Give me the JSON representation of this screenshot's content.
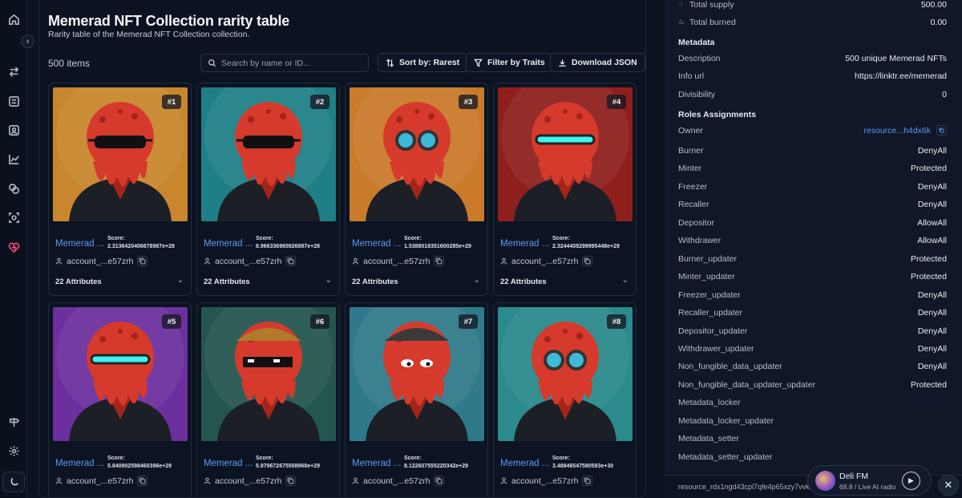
{
  "header": {
    "title": "Memerad NFT Collection rarity table",
    "subtitle": "Rarity table of the Memerad NFT Collection collection."
  },
  "toolbar": {
    "item_count": "500 items",
    "search_placeholder": "Search by name or ID...",
    "sort_label": "Sort by: Rarest",
    "filter_label": "Filter by Traits",
    "download_label": "Download JSON"
  },
  "cards": [
    {
      "rank": "#1",
      "name": "Memerad ...",
      "score_label": "Score:",
      "score": "2.3136420406678987e+28",
      "account": "account_...e57zrh",
      "attributes": "22 Attributes",
      "bg": "#c9862d",
      "accessory": "sunglasses"
    },
    {
      "rank": "#2",
      "name": "Memerad ...",
      "score_label": "Score:",
      "score": "8.966336965926887e+28",
      "account": "account_...e57zrh",
      "attributes": "22 Attributes",
      "bg": "#1f7f86",
      "accessory": "sunglasses"
    },
    {
      "rank": "#3",
      "name": "Memerad ...",
      "score_label": "Score:",
      "score": "1.5388018351600285e+29",
      "account": "account_...e57zrh",
      "attributes": "22 Attributes",
      "bg": "#c97a2b",
      "accessory": "goggles"
    },
    {
      "rank": "#4",
      "name": "Memerad ...",
      "score_label": "Score:",
      "score": "2.3244408299995448e+29",
      "account": "account_...e57zrh",
      "attributes": "22 Attributes",
      "bg": "#8e1f1c",
      "accessory": "visor"
    },
    {
      "rank": "#5",
      "name": "Memerad ...",
      "score_label": "Score:",
      "score": "5.840902598460396e+29",
      "account": "account_...e57zrh",
      "attributes": "22 Attributes",
      "bg": "#6c2f9e",
      "accessory": "visor"
    },
    {
      "rank": "#6",
      "name": "Memerad ...",
      "score_label": "Score:",
      "score": "5.979672675558968e+29",
      "account": "account_...e57zrh",
      "attributes": "22 Attributes",
      "bg": "#24564f",
      "accessory": "pixel"
    },
    {
      "rank": "#7",
      "name": "Memerad ...",
      "score_label": "Score:",
      "score": "8.122607555220342e+29",
      "account": "account_...e57zrh",
      "attributes": "22 Attributes",
      "bg": "#2f7a8a",
      "accessory": "cap"
    },
    {
      "rank": "#8",
      "name": "Memerad ...",
      "score_label": "Score:",
      "score": "3.48846547580593e+30",
      "account": "account_...e57zrh",
      "attributes": "22 Attributes",
      "bg": "#2a8a8c",
      "accessory": "goggles"
    }
  ],
  "sidebar": {
    "supply": [
      {
        "label": "Total supply",
        "value": "500.00"
      },
      {
        "label": "Total burned",
        "value": "0.00"
      }
    ],
    "metadata_heading": "Metadata",
    "metadata": [
      {
        "label": "Description",
        "value": "500 unique Memerad NFTs"
      },
      {
        "label": "Info url",
        "value": "https://linktr.ee/memerad"
      },
      {
        "label": "Divisibility",
        "value": "0"
      }
    ],
    "roles_heading": "Roles Assignments",
    "owner": {
      "label": "Owner",
      "value": "resource...h4dx6k"
    },
    "roles": [
      {
        "label": "Burner",
        "value": "DenyAll"
      },
      {
        "label": "Minter",
        "value": "Protected"
      },
      {
        "label": "Freezer",
        "value": "DenyAll"
      },
      {
        "label": "Recaller",
        "value": "DenyAll"
      },
      {
        "label": "Depositor",
        "value": "AllowAll"
      },
      {
        "label": "Withdrawer",
        "value": "AllowAll"
      },
      {
        "label": "Burner_updater",
        "value": "Protected"
      },
      {
        "label": "Minter_updater",
        "value": "Protected"
      },
      {
        "label": "Freezer_updater",
        "value": "DenyAll"
      },
      {
        "label": "Recaller_updater",
        "value": "DenyAll"
      },
      {
        "label": "Depositor_updater",
        "value": "DenyAll"
      },
      {
        "label": "Withdrawer_updater",
        "value": "DenyAll"
      },
      {
        "label": "Non_fungible_data_updater",
        "value": "DenyAll"
      },
      {
        "label": "Non_fungible_data_updater_updater",
        "value": "Protected"
      },
      {
        "label": "Metadata_locker",
        "value": ""
      },
      {
        "label": "Metadata_locker_updater",
        "value": ""
      },
      {
        "label": "Metadata_setter",
        "value": ""
      },
      {
        "label": "Metadata_setter_updater",
        "value": ""
      }
    ],
    "resource_address": "resource_rdx1ngd43cpl7qfe4p65xzy7vvk"
  },
  "radio": {
    "station": "Deli FM",
    "subtitle": "68.8 / Live AI radio"
  },
  "colors": {
    "accent": "#5b9cf0",
    "active_nav": "#e0457b",
    "background": "#0b1220"
  }
}
